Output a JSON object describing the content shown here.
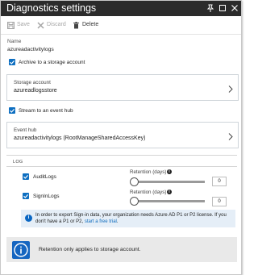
{
  "window": {
    "title": "Diagnostics settings"
  },
  "toolbar": {
    "save_label": "Save",
    "discard_label": "Discard",
    "delete_label": "Delete"
  },
  "form": {
    "name_label": "Name",
    "name_value": "azureadactivitylogs",
    "archive_label": "Archive to a storage account",
    "archive_checked": true,
    "storage_label": "Storage account",
    "storage_value": "azureadlogsstore",
    "stream_label": "Stream to an event hub",
    "stream_checked": true,
    "eventhub_label": "Event hub",
    "eventhub_value": "azureadactivitylogs (RootManageSharedAccessKey)"
  },
  "log": {
    "section_label": "LOG",
    "rows": [
      {
        "name": "AuditLogs",
        "checked": true,
        "retention_label": "Retention (days)",
        "retention_value": "0"
      },
      {
        "name": "SignInLogs",
        "checked": true,
        "retention_label": "Retention (days)",
        "retention_value": "0"
      }
    ]
  },
  "notice": {
    "text": "In order to export Sign-in data, your organization needs Azure AD P1 or P2 license. If you don't have a P1 or P2,",
    "link_text": "start a free trial",
    "suffix": "."
  },
  "footer": {
    "text": "Retention only applies to storage account."
  },
  "colors": {
    "titlebar": "#2b2b2b",
    "accent": "#0e6fc1",
    "link": "#0f6cbd",
    "notice_bg": "#e5eef7",
    "footer_bg": "#e9e9e9"
  },
  "icons": {
    "pin": "pin-icon",
    "maximize": "maximize-icon",
    "close": "close-icon",
    "save": "save-icon",
    "discard": "discard-icon",
    "delete": "delete-icon",
    "chevron": "chevron-right-icon",
    "info": "info-icon"
  }
}
